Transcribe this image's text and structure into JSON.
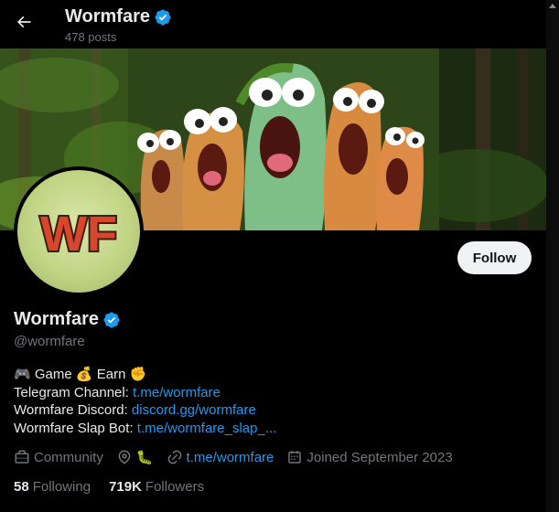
{
  "header": {
    "name": "Wormfare",
    "post_count": "478 posts"
  },
  "banner": {
    "icon": "worm-cartoon-banner"
  },
  "avatar": {
    "logo_text": "WF"
  },
  "profile": {
    "display_name": "Wormfare",
    "handle": "@wormfare",
    "follow_label": "Follow"
  },
  "bio": {
    "line1": {
      "game_emoji": "🎮",
      "game": "Game",
      "money_emoji": "💰",
      "earn": "Earn",
      "fist_emoji": "✊"
    },
    "telegram_label": "Telegram Channel: ",
    "telegram_link": "t.me/wormfare",
    "discord_label": "Wormfare Discord: ",
    "discord_link": "discord.gg/wormfare",
    "slapbot_label": "Wormfare Slap Bot: ",
    "slapbot_link": "t.me/wormfare_slap_..."
  },
  "meta": {
    "category": "Community",
    "location_emoji": "🐛",
    "website": "t.me/wormfare",
    "joined": "Joined September 2023"
  },
  "stats": {
    "following_count": "58",
    "following_label": "Following",
    "followers_count": "719K",
    "followers_label": "Followers"
  },
  "colors": {
    "accent": "#1d9bf0",
    "background": "#000000",
    "muted": "#71767b",
    "text": "#e7e9ea"
  }
}
